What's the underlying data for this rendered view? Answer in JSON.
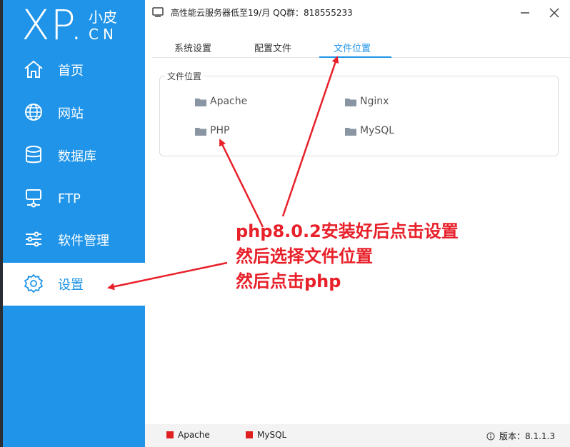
{
  "window": {
    "title": "高性能云服务器低至19/月  QQ群：818555233"
  },
  "logo": {
    "xp": "XP.",
    "cn_top": "小皮",
    "cn_bottom": "CN"
  },
  "sidebar": {
    "items": [
      {
        "label": "首页",
        "icon": "home-icon"
      },
      {
        "label": "网站",
        "icon": "globe-icon"
      },
      {
        "label": "数据库",
        "icon": "database-icon"
      },
      {
        "label": "FTP",
        "icon": "server-icon"
      },
      {
        "label": "软件管理",
        "icon": "sliders-icon"
      },
      {
        "label": "设置",
        "icon": "gear-icon",
        "active": true
      }
    ]
  },
  "tabs": [
    {
      "label": "系统设置"
    },
    {
      "label": "配置文件"
    },
    {
      "label": "文件位置",
      "active": true
    }
  ],
  "file_location": {
    "legend": "文件位置",
    "links": [
      "Apache",
      "Nginx",
      "PHP",
      "MySQL"
    ]
  },
  "annotation": {
    "line1": "php8.0.2安装好后点击设置",
    "line2": "然后选择文件位置",
    "line3": "然后点击php"
  },
  "statusbar": {
    "services": [
      "Apache",
      "MySQL"
    ],
    "version": "版本：8.1.1.3"
  },
  "colors": {
    "accent": "#1f94e8",
    "annotation": "#e8202a",
    "status_stopped": "#e02020"
  }
}
